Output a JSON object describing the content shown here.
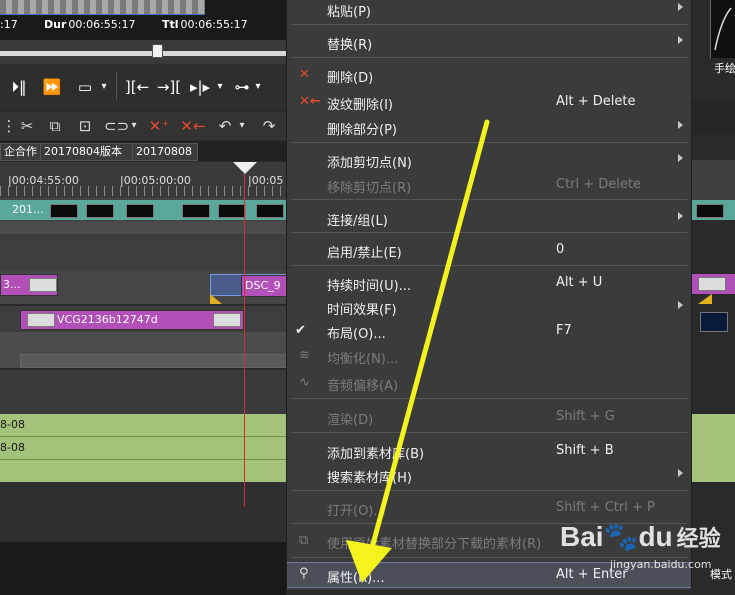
{
  "timecode": {
    "cur_fragment": ":17",
    "dur_label": "Dur",
    "dur_value": "00:06:55:17",
    "ttl_label": "Ttl",
    "ttl_value": "00:06:55:17"
  },
  "tabs": [
    "企合作",
    "20170804版本",
    "20170808"
  ],
  "ruler": {
    "labels": [
      "|00:04:55:00",
      "|00:05:00:00",
      "|00:05"
    ]
  },
  "clips": {
    "top_teal_label": "201...",
    "magenta_left_label": "3...",
    "dsc_label": "DSC_9",
    "vcg_label": "VCG2136b12747d",
    "green_labels": [
      "8-08",
      "8-08"
    ]
  },
  "right_strip": {
    "label_top": "手绘",
    "label_bottom": "模式"
  },
  "menu": {
    "items": [
      {
        "label": "粘贴(P)",
        "key": "",
        "submenu": true,
        "disabled": false,
        "icon": ""
      },
      {
        "label": "替换(R)",
        "key": "",
        "submenu": true,
        "disabled": false,
        "icon": ""
      },
      {
        "label": "删除(D)",
        "key": "",
        "submenu": false,
        "disabled": false,
        "icon": "delete-icon"
      },
      {
        "label": "波纹删除(I)",
        "key": "Alt + Delete",
        "submenu": false,
        "disabled": false,
        "icon": "ripple-delete-icon"
      },
      {
        "label": "删除部分(P)",
        "key": "",
        "submenu": true,
        "disabled": false,
        "icon": ""
      },
      {
        "label": "添加剪切点(N)",
        "key": "",
        "submenu": true,
        "disabled": false,
        "icon": ""
      },
      {
        "label": "移除剪切点(R)",
        "key": "Ctrl + Delete",
        "submenu": false,
        "disabled": true,
        "icon": ""
      },
      {
        "label": "连接/组(L)",
        "key": "",
        "submenu": true,
        "disabled": false,
        "icon": ""
      },
      {
        "label": "启用/禁止(E)",
        "key": "0",
        "submenu": false,
        "disabled": false,
        "icon": ""
      },
      {
        "label": "持续时间(U)...",
        "key": "Alt + U",
        "submenu": false,
        "disabled": false,
        "icon": ""
      },
      {
        "label": "时间效果(F)",
        "key": "",
        "submenu": true,
        "disabled": false,
        "icon": ""
      },
      {
        "label": "布局(O)...",
        "key": "F7",
        "submenu": false,
        "disabled": false,
        "icon": "check-icon"
      },
      {
        "label": "均衡化(N)...",
        "key": "",
        "submenu": false,
        "disabled": true,
        "icon": "normalize-icon"
      },
      {
        "label": "音频偏移(A)",
        "key": "",
        "submenu": false,
        "disabled": true,
        "icon": "audio-offset-icon"
      },
      {
        "label": "渲染(D)",
        "key": "Shift + G",
        "submenu": false,
        "disabled": true,
        "icon": ""
      },
      {
        "label": "添加到素材库(B)",
        "key": "Shift + B",
        "submenu": false,
        "disabled": false,
        "icon": ""
      },
      {
        "label": "搜索素材库(H)",
        "key": "",
        "submenu": true,
        "disabled": false,
        "icon": ""
      },
      {
        "label": "打开(O)...",
        "key": "Shift + Ctrl + P",
        "submenu": false,
        "disabled": true,
        "icon": ""
      },
      {
        "label": "使用原始素材替换部分下载的素材(R)",
        "key": "",
        "submenu": false,
        "disabled": true,
        "icon": "replace-source-icon"
      },
      {
        "label": "属性(R)...",
        "key": "Alt + Enter",
        "submenu": false,
        "disabled": false,
        "icon": "properties-icon"
      }
    ]
  },
  "colors": {
    "arrow": "#f5f31e",
    "playhead": "#d23030",
    "clip_teal": "#5aa79b",
    "clip_magenta": "#b24fb8",
    "clip_green": "#a3c27a"
  },
  "watermark": {
    "brand": "Bai",
    "brand_suffix": "du",
    "service": "经验",
    "url": "jingyan.baidu.com"
  }
}
